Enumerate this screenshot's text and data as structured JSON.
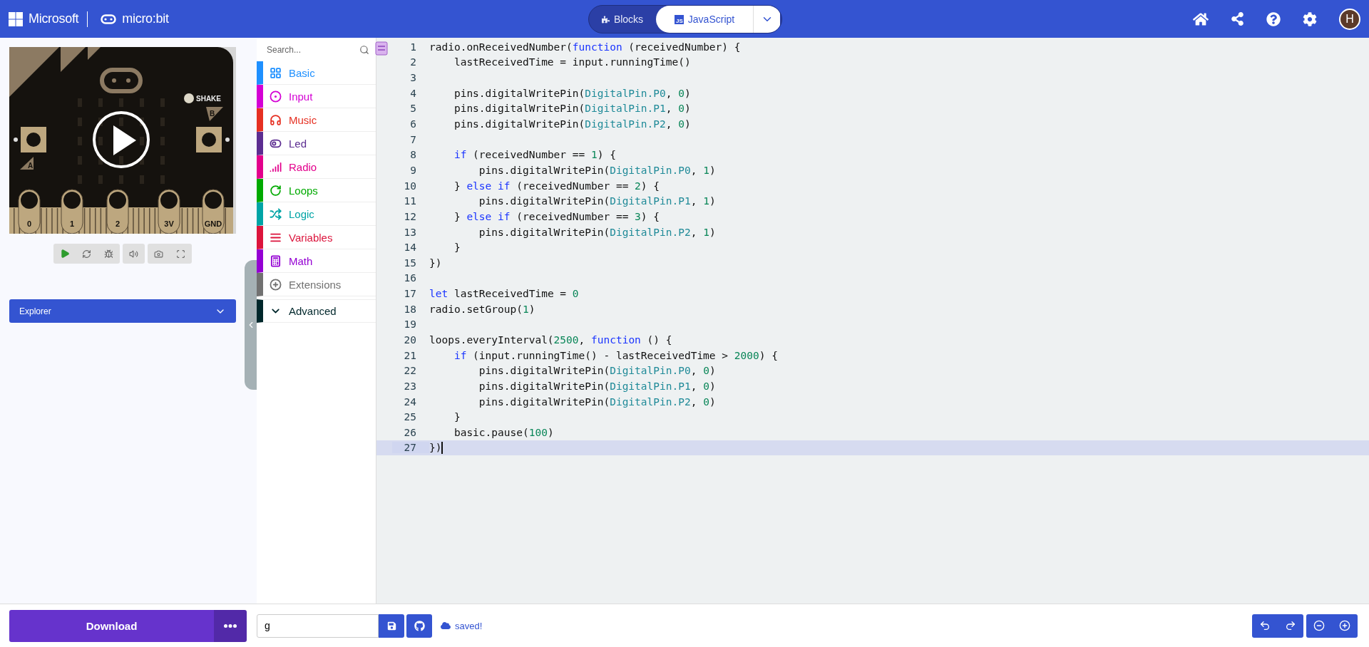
{
  "header": {
    "brand": "Microsoft",
    "product": "micro:bit",
    "avatar": "H",
    "modes": [
      {
        "label": "Blocks",
        "kind": "blocks",
        "selected": false
      },
      {
        "label": "JavaScript",
        "kind": "javascript",
        "selected": true
      }
    ],
    "js_badge": "JS"
  },
  "simulator": {
    "pins": [
      "0",
      "1",
      "2",
      "3V",
      "GND"
    ],
    "shake_label": "SHAKE",
    "button_a": "A",
    "button_b": "B",
    "explorer": "Explorer"
  },
  "toolbox": {
    "search_placeholder": "Search...",
    "categories": [
      {
        "label": "Basic",
        "kind": "grid",
        "color": "#1e90ff"
      },
      {
        "label": "Input",
        "kind": "ring",
        "color": "#d400d4"
      },
      {
        "label": "Music",
        "kind": "headphones",
        "color": "#e63022"
      },
      {
        "label": "Led",
        "kind": "toggle",
        "color": "#5c2d91"
      },
      {
        "label": "Radio",
        "kind": "signal",
        "color": "#e3008c"
      },
      {
        "label": "Loops",
        "kind": "loop",
        "color": "#00aa00"
      },
      {
        "label": "Logic",
        "kind": "shuffle",
        "color": "#00a4a6"
      },
      {
        "label": "Variables",
        "kind": "lines",
        "color": "#dc143c"
      },
      {
        "label": "Math",
        "kind": "calculator",
        "color": "#9400d3"
      },
      {
        "label": "Extensions",
        "kind": "plus",
        "color": "#717171"
      },
      {
        "label": "Advanced",
        "kind": "chevron",
        "color": "#00272b"
      }
    ]
  },
  "editor": {
    "lines": [
      {
        "no": "1",
        "current": false,
        "tokens": [
          {
            "text": "radio.onReceivedNumber(",
            "kind": "plain"
          },
          {
            "text": "function",
            "kind": "keyword"
          },
          {
            "text": " (receivedNumber) {",
            "kind": "plain"
          }
        ]
      },
      {
        "no": "2",
        "current": false,
        "tokens": [
          {
            "text": "    lastReceivedTime = input.runningTime()",
            "kind": "plain"
          }
        ]
      },
      {
        "no": "3",
        "current": false
      },
      {
        "no": "4",
        "current": false,
        "tokens": [
          {
            "text": "    pins.digitalWritePin(",
            "kind": "plain"
          },
          {
            "text": "DigitalPin.P0",
            "kind": "type"
          },
          {
            "text": ", ",
            "kind": "plain"
          },
          {
            "text": "0",
            "kind": "number"
          },
          {
            "text": ")",
            "kind": "plain"
          }
        ]
      },
      {
        "no": "5",
        "current": false,
        "tokens": [
          {
            "text": "    pins.digitalWritePin(",
            "kind": "plain"
          },
          {
            "text": "DigitalPin.P1",
            "kind": "type"
          },
          {
            "text": ", ",
            "kind": "plain"
          },
          {
            "text": "0",
            "kind": "number"
          },
          {
            "text": ")",
            "kind": "plain"
          }
        ]
      },
      {
        "no": "6",
        "current": false,
        "tokens": [
          {
            "text": "    pins.digitalWritePin(",
            "kind": "plain"
          },
          {
            "text": "DigitalPin.P2",
            "kind": "type"
          },
          {
            "text": ", ",
            "kind": "plain"
          },
          {
            "text": "0",
            "kind": "number"
          },
          {
            "text": ")",
            "kind": "plain"
          }
        ]
      },
      {
        "no": "7",
        "current": false
      },
      {
        "no": "8",
        "current": false,
        "tokens": [
          {
            "text": "    if",
            "kind": "keyword"
          },
          {
            "text": " (receivedNumber == ",
            "kind": "plain"
          },
          {
            "text": "1",
            "kind": "number"
          },
          {
            "text": ") {",
            "kind": "plain"
          }
        ]
      },
      {
        "no": "9",
        "current": false,
        "tokens": [
          {
            "text": "        pins.digitalWritePin(",
            "kind": "plain"
          },
          {
            "text": "DigitalPin.P0",
            "kind": "type"
          },
          {
            "text": ", ",
            "kind": "plain"
          },
          {
            "text": "1",
            "kind": "number"
          },
          {
            "text": ")",
            "kind": "plain"
          }
        ]
      },
      {
        "no": "10",
        "current": false,
        "tokens": [
          {
            "text": "    } ",
            "kind": "plain"
          },
          {
            "text": "else if",
            "kind": "keyword"
          },
          {
            "text": " (receivedNumber == ",
            "kind": "plain"
          },
          {
            "text": "2",
            "kind": "number"
          },
          {
            "text": ") {",
            "kind": "plain"
          }
        ]
      },
      {
        "no": "11",
        "current": false,
        "tokens": [
          {
            "text": "        pins.digitalWritePin(",
            "kind": "plain"
          },
          {
            "text": "DigitalPin.P1",
            "kind": "type"
          },
          {
            "text": ", ",
            "kind": "plain"
          },
          {
            "text": "1",
            "kind": "number"
          },
          {
            "text": ")",
            "kind": "plain"
          }
        ]
      },
      {
        "no": "12",
        "current": false,
        "tokens": [
          {
            "text": "    } ",
            "kind": "plain"
          },
          {
            "text": "else if",
            "kind": "keyword"
          },
          {
            "text": " (receivedNumber == ",
            "kind": "plain"
          },
          {
            "text": "3",
            "kind": "number"
          },
          {
            "text": ") {",
            "kind": "plain"
          }
        ]
      },
      {
        "no": "13",
        "current": false,
        "tokens": [
          {
            "text": "        pins.digitalWritePin(",
            "kind": "plain"
          },
          {
            "text": "DigitalPin.P2",
            "kind": "type"
          },
          {
            "text": ", ",
            "kind": "plain"
          },
          {
            "text": "1",
            "kind": "number"
          },
          {
            "text": ")",
            "kind": "plain"
          }
        ]
      },
      {
        "no": "14",
        "current": false,
        "tokens": [
          {
            "text": "    }",
            "kind": "plain"
          }
        ]
      },
      {
        "no": "15",
        "current": false,
        "tokens": [
          {
            "text": "})",
            "kind": "plain"
          }
        ]
      },
      {
        "no": "16",
        "current": false
      },
      {
        "no": "17",
        "current": false,
        "tokens": [
          {
            "text": "let",
            "kind": "keyword"
          },
          {
            "text": " lastReceivedTime = ",
            "kind": "plain"
          },
          {
            "text": "0",
            "kind": "number"
          }
        ]
      },
      {
        "no": "18",
        "current": false,
        "tokens": [
          {
            "text": "radio.setGroup(",
            "kind": "plain"
          },
          {
            "text": "1",
            "kind": "number"
          },
          {
            "text": ")",
            "kind": "plain"
          }
        ]
      },
      {
        "no": "19",
        "current": false
      },
      {
        "no": "20",
        "current": false,
        "tokens": [
          {
            "text": "loops.everyInterval(",
            "kind": "plain"
          },
          {
            "text": "2500",
            "kind": "number"
          },
          {
            "text": ", ",
            "kind": "plain"
          },
          {
            "text": "function",
            "kind": "keyword"
          },
          {
            "text": " () {",
            "kind": "plain"
          }
        ]
      },
      {
        "no": "21",
        "current": false,
        "tokens": [
          {
            "text": "    if",
            "kind": "keyword"
          },
          {
            "text": " (input.runningTime() - lastReceivedTime > ",
            "kind": "plain"
          },
          {
            "text": "2000",
            "kind": "number"
          },
          {
            "text": ") {",
            "kind": "plain"
          }
        ]
      },
      {
        "no": "22",
        "current": false,
        "tokens": [
          {
            "text": "        pins.digitalWritePin(",
            "kind": "plain"
          },
          {
            "text": "DigitalPin.P0",
            "kind": "type"
          },
          {
            "text": ", ",
            "kind": "plain"
          },
          {
            "text": "0",
            "kind": "number"
          },
          {
            "text": ")",
            "kind": "plain"
          }
        ]
      },
      {
        "no": "23",
        "current": false,
        "tokens": [
          {
            "text": "        pins.digitalWritePin(",
            "kind": "plain"
          },
          {
            "text": "DigitalPin.P1",
            "kind": "type"
          },
          {
            "text": ", ",
            "kind": "plain"
          },
          {
            "text": "0",
            "kind": "number"
          },
          {
            "text": ")",
            "kind": "plain"
          }
        ]
      },
      {
        "no": "24",
        "current": false,
        "tokens": [
          {
            "text": "        pins.digitalWritePin(",
            "kind": "plain"
          },
          {
            "text": "DigitalPin.P2",
            "kind": "type"
          },
          {
            "text": ", ",
            "kind": "plain"
          },
          {
            "text": "0",
            "kind": "number"
          },
          {
            "text": ")",
            "kind": "plain"
          }
        ]
      },
      {
        "no": "25",
        "current": false,
        "tokens": [
          {
            "text": "    }",
            "kind": "plain"
          }
        ]
      },
      {
        "no": "26",
        "current": false,
        "tokens": [
          {
            "text": "    basic.pause(",
            "kind": "plain"
          },
          {
            "text": "100",
            "kind": "number"
          },
          {
            "text": ")",
            "kind": "plain"
          }
        ]
      },
      {
        "no": "27",
        "current": true,
        "tokens": [
          {
            "text": "})",
            "kind": "plain"
          }
        ]
      }
    ]
  },
  "footer": {
    "download": "Download",
    "project_name": "g",
    "status": "saved!"
  }
}
